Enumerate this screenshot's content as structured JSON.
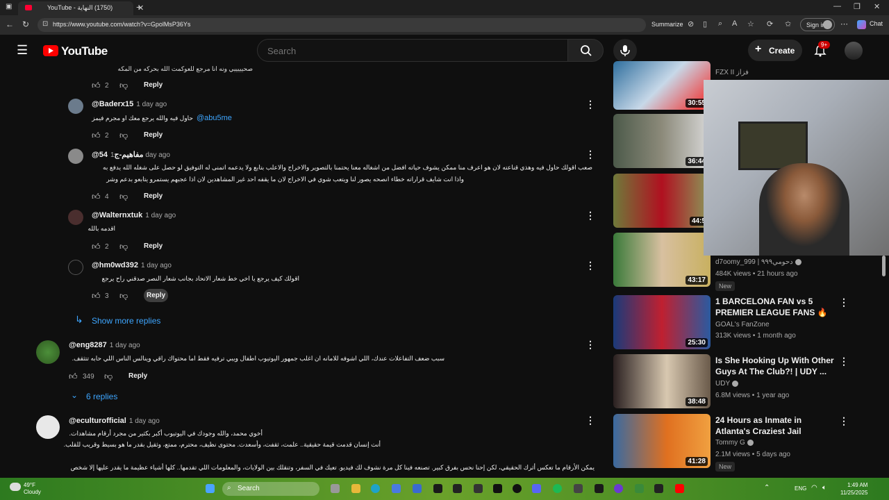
{
  "browser": {
    "tab_title": "YouTube - ‏(1750) النهاية",
    "url": "https://www.youtube.com/watch?v=GpolMsP36Ys",
    "summarize": "Summarize",
    "signin": "Sign in",
    "chat": "Chat"
  },
  "header": {
    "logo": "YouTube",
    "search_placeholder": "Search",
    "create": "Create",
    "notif_count": "9+"
  },
  "comments": {
    "top_partial_text": "صحيييييي ونه انا مرجع للعوكمت الله بحركه من المكه",
    "reply_label": "Reply",
    "show_more_replies": "Show more replies",
    "items": [
      {
        "likes": "2"
      },
      {
        "author": "@Baderx15",
        "time": "1 day ago",
        "text": "حاول فيه والله يرجع معك او مجرم فيمز",
        "mention": "@abu5me",
        "likes": "2"
      },
      {
        "author": "@مفاهيم-ج54",
        "time": "1 day ago",
        "text1": "صعب اقولك حاول فيه وهذي قناعته لان هو اعرف منا ممكن يشوف حياته افضل من اشغاله معنا يحتمنا بالتصوير والاخراج والاعلب بتابع ولا يدعمه اتمنى له التوفيق لو حصل على شغله الله يدفع به",
        "text2": "واذا انت شايف قراراته خطاء انصحه يصور لنا ويتعب شوي في الاخراج لان ما يقفه احد غير المشاهدين لان اذا عجبهم يستمرو يتابعو بدعم وشر",
        "likes": "4"
      },
      {
        "author": "@Walternxtuk",
        "time": "1 day ago",
        "text": "اقدمه بالله",
        "likes": "2"
      },
      {
        "author": "@hm0wd392",
        "time": "1 day ago",
        "text": "اقولك كيف يرجع يا اخي خط شعار الاتحاد بجانب شعار النصر صدقني راح يرجع",
        "likes": "3"
      }
    ],
    "main": [
      {
        "author": "@eng8287",
        "time": "1 day ago",
        "text": "سبب ضعف التفاعلات عندك، اللي اشوفه للامانه ان اغلب جمهور اليوتيوب اطفال ويبي ترفيه فقط اما محتواك راقي وينالس الناس اللي حابه تتثقف.",
        "likes": "349",
        "replies": "6 replies"
      },
      {
        "author": "@eculturofficial",
        "time": "1 day ago",
        "text1": "أخوي محمد، والله وجودك في اليوتيوب أكبر بكثير من مجرد أرقام مشاهدات.",
        "text2": "أنت إنسان قدمت قيمة حقيقية.. علمت، ثقفت، وأسعدت. محتوى نظيف، محترم، ممتع، وثقيل بقدر ما هو بسيط وقريب للقلب.",
        "text3": "يمكن الأرقام ما تعكس أثرك الحقيقي، لكن إحنا نحس بفرق كبير. تصنعه فينا كل مرة نشوف لك فيديو. تعيك في السفر، وتنقلك بين الولايات، والمعلومات اللي تقدمها.. كلها أشياء عظيمة ما يقدر عليها إلا شخص"
      }
    ]
  },
  "sidebar": {
    "videos": [
      {
        "duration": "30:55",
        "title": "",
        "channel": "FZX II فزاز"
      },
      {
        "duration": "36:44"
      },
      {
        "duration": "44:5"
      },
      {
        "duration": "43:17",
        "channel": "d7oomy_999 | دحومي٩٩٩",
        "meta": "484K views • 21 hours ago",
        "new": "New"
      },
      {
        "duration": "25:30",
        "title": "1 BARCELONA FAN vs 5 PREMIER LEAGUE FANS 🔥",
        "channel": "GOAL's FanZone",
        "meta": "313K views • 1 month ago"
      },
      {
        "duration": "38:48",
        "title": "Is She Hooking Up With Other Guys At The Club?! | UDY ...",
        "channel": "UDY",
        "meta": "6.8M views • 1 year ago"
      },
      {
        "duration": "41:28",
        "title": "24 Hours as Inmate in Atlanta's Craziest Jail",
        "channel": "Tommy G",
        "meta": "2.1M views • 5 days ago",
        "new": "New"
      }
    ]
  },
  "taskbar": {
    "temp": "49°F",
    "weather": "Cloudy",
    "search": "Search",
    "lang": "ENG",
    "time": "1:49 AM",
    "date": "11/25/2025"
  },
  "colors": {
    "accent": "#3ea6ff",
    "brand": "#ff0000",
    "bg": "#0f0f0f"
  }
}
